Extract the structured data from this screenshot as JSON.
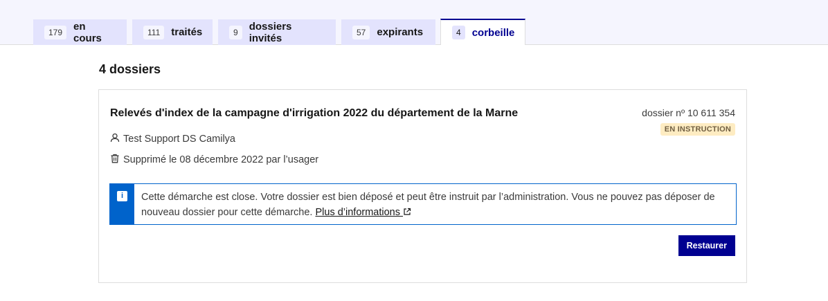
{
  "tabs": [
    {
      "count": "179",
      "label": "en cours",
      "active": false
    },
    {
      "count": "111",
      "label": "traités",
      "active": false
    },
    {
      "count": "9",
      "label": "dossiers invités",
      "active": false
    },
    {
      "count": "57",
      "label": "expirants",
      "active": false
    },
    {
      "count": "4",
      "label": "corbeille",
      "active": true
    }
  ],
  "list": {
    "count_title": "4 dossiers"
  },
  "card": {
    "title": "Relevés d'index de la campagne d'irrigation 2022 du département de la Marne",
    "dossier_number": "dossier nº 10 611 354",
    "status_badge": "EN INSTRUCTION",
    "user": "Test Support DS Camilya",
    "deleted": "Supprimé le 08 décembre 2022 par l’usager",
    "notice": {
      "icon_glyph": "i",
      "text": "Cette démarche est close. Votre dossier est bien déposé et peut être instruit par l’administration. Vous ne pouvez pas déposer de nouveau dossier pour cette démarche. ",
      "link_label": "Plus d’informations"
    },
    "restore_label": "Restaurer"
  },
  "colors": {
    "primary": "#000091",
    "info": "#0063cb",
    "badge_bg": "#feecc2",
    "badge_text": "#716043",
    "tab_bg": "#e3e3fd"
  },
  "icons": [
    "user-icon",
    "trash-icon",
    "info-icon",
    "external-link-icon"
  ]
}
